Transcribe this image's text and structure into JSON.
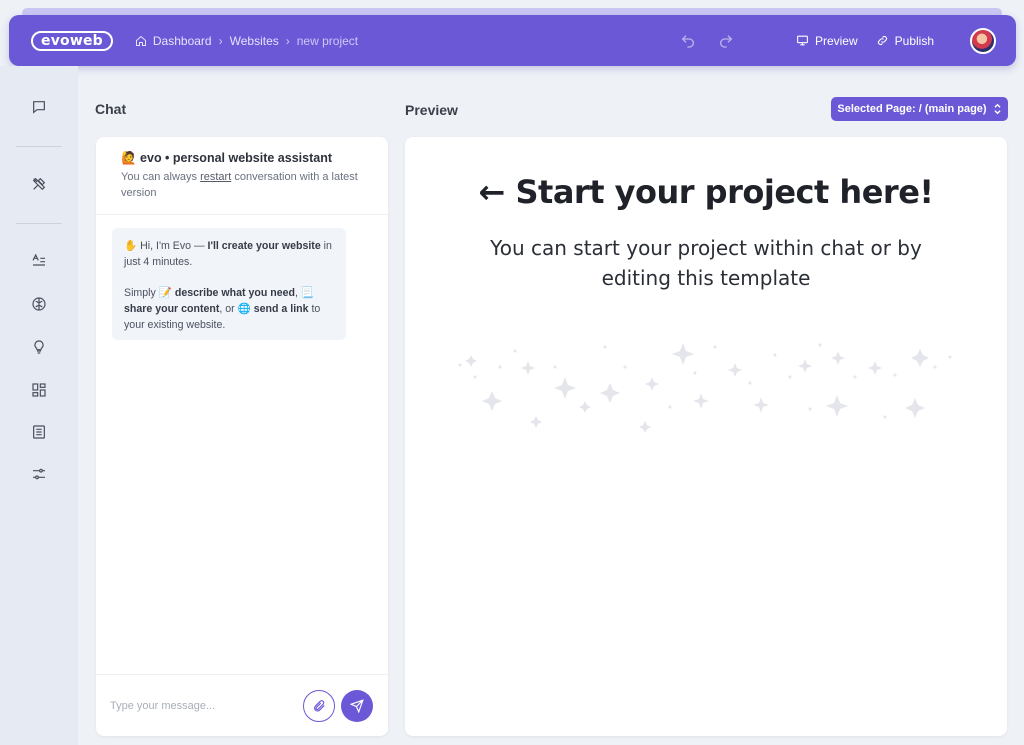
{
  "app": {
    "logo": "evoweb",
    "breadcrumbs": [
      "Dashboard",
      "Websites",
      "new project"
    ],
    "actions": {
      "preview": "Preview",
      "publish": "Publish"
    }
  },
  "chat": {
    "section_title": "Chat",
    "header_title": "🙋 evo • personal website assistant",
    "header_sub_before": "You can always ",
    "header_sub_link": "restart",
    "header_sub_after": " conversation with a latest version",
    "message": {
      "l1_before": "✋ Hi, I'm Evo — ",
      "l1_bold": "I'll create your website",
      "l1_after": " in just 4 minutes.",
      "l2_before": "Simply 📝 ",
      "l2_bold1": "describe what you need",
      "l2_mid1": ", 📃 ",
      "l2_bold2": "share your content",
      "l2_mid2": ", or 🌐 ",
      "l2_bold3": "send a link",
      "l2_after": " to your existing website."
    },
    "input_placeholder": "Type your message..."
  },
  "preview": {
    "section_title": "Preview",
    "selected_page": "Selected Page: / (main page)",
    "heading": "Start your project here!",
    "subheading": "You can start your project within chat or by editing this template"
  }
}
